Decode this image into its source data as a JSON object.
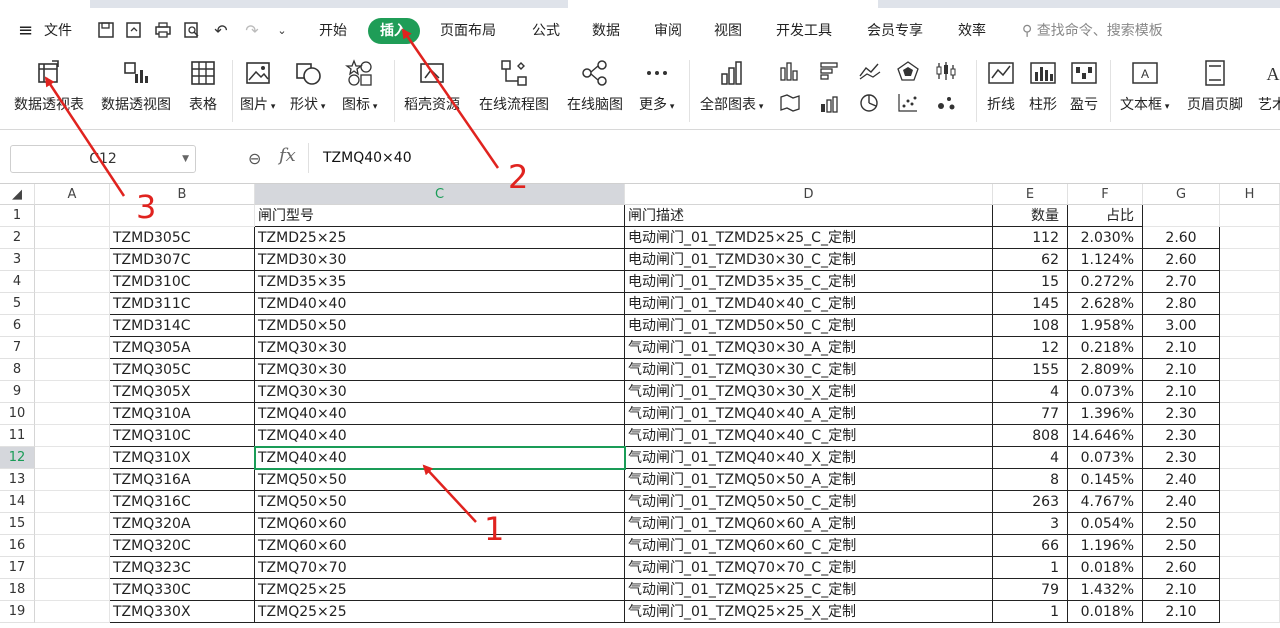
{
  "menu": {
    "file_label": "文件",
    "tabs": [
      "开始",
      "插入",
      "页面布局",
      "公式",
      "数据",
      "审阅",
      "视图",
      "开发工具",
      "会员专享",
      "效率"
    ],
    "search_placeholder": "查找命令、搜索模板"
  },
  "ribbon": {
    "pivot_table": "数据透视表",
    "pivot_chart": "数据透视图",
    "table": "表格",
    "picture": "图片",
    "shape": "形状",
    "icon": "图标",
    "resource": "稻壳资源",
    "flowchart": "在线流程图",
    "mindmap": "在线脑图",
    "more": "更多",
    "all_charts": "全部图表",
    "sparkline_line": "折线",
    "sparkline_column": "柱形",
    "sparkline_winloss": "盈亏",
    "textbox": "文本框",
    "header_footer": "页眉页脚",
    "wordart": "艺术"
  },
  "formula_bar": {
    "name_box": "C12",
    "fx": "fx",
    "content": "TZMQ40×40"
  },
  "columns": [
    "A",
    "B",
    "C",
    "D",
    "E",
    "F",
    "G",
    "H"
  ],
  "header_row": {
    "b": "",
    "c": "闸门型号",
    "d": "闸门描述",
    "e": "数量",
    "f": "占比",
    "g": ""
  },
  "rows": [
    {
      "n": "1"
    },
    {
      "n": "2",
      "b": "TZMD305C",
      "c": "TZMD25×25",
      "d": "电动闸门_01_TZMD25×25_C_定制",
      "e": "112",
      "f": "2.030%",
      "g": "2.60"
    },
    {
      "n": "3",
      "b": "TZMD307C",
      "c": "TZMD30×30",
      "d": "电动闸门_01_TZMD30×30_C_定制",
      "e": "62",
      "f": "1.124%",
      "g": "2.60"
    },
    {
      "n": "4",
      "b": "TZMD310C",
      "c": "TZMD35×35",
      "d": "电动闸门_01_TZMD35×35_C_定制",
      "e": "15",
      "f": "0.272%",
      "g": "2.70"
    },
    {
      "n": "5",
      "b": "TZMD311C",
      "c": "TZMD40×40",
      "d": "电动闸门_01_TZMD40×40_C_定制",
      "e": "145",
      "f": "2.628%",
      "g": "2.80"
    },
    {
      "n": "6",
      "b": "TZMD314C",
      "c": "TZMD50×50",
      "d": "电动闸门_01_TZMD50×50_C_定制",
      "e": "108",
      "f": "1.958%",
      "g": "3.00"
    },
    {
      "n": "7",
      "b": "TZMQ305A",
      "c": "TZMQ30×30",
      "d": "气动闸门_01_TZMQ30×30_A_定制",
      "e": "12",
      "f": "0.218%",
      "g": "2.10"
    },
    {
      "n": "8",
      "b": "TZMQ305C",
      "c": "TZMQ30×30",
      "d": "气动闸门_01_TZMQ30×30_C_定制",
      "e": "155",
      "f": "2.809%",
      "g": "2.10"
    },
    {
      "n": "9",
      "b": "TZMQ305X",
      "c": "TZMQ30×30",
      "d": "气动闸门_01_TZMQ30×30_X_定制",
      "e": "4",
      "f": "0.073%",
      "g": "2.10"
    },
    {
      "n": "10",
      "b": "TZMQ310A",
      "c": "TZMQ40×40",
      "d": "气动闸门_01_TZMQ40×40_A_定制",
      "e": "77",
      "f": "1.396%",
      "g": "2.30"
    },
    {
      "n": "11",
      "b": "TZMQ310C",
      "c": "TZMQ40×40",
      "d": "气动闸门_01_TZMQ40×40_C_定制",
      "e": "808",
      "f": "14.646%",
      "g": "2.30"
    },
    {
      "n": "12",
      "b": "TZMQ310X",
      "c": "TZMQ40×40",
      "d": "气动闸门_01_TZMQ40×40_X_定制",
      "e": "4",
      "f": "0.073%",
      "g": "2.30"
    },
    {
      "n": "13",
      "b": "TZMQ316A",
      "c": "TZMQ50×50",
      "d": "气动闸门_01_TZMQ50×50_A_定制",
      "e": "8",
      "f": "0.145%",
      "g": "2.40"
    },
    {
      "n": "14",
      "b": "TZMQ316C",
      "c": "TZMQ50×50",
      "d": "气动闸门_01_TZMQ50×50_C_定制",
      "e": "263",
      "f": "4.767%",
      "g": "2.40"
    },
    {
      "n": "15",
      "b": "TZMQ320A",
      "c": "TZMQ60×60",
      "d": "气动闸门_01_TZMQ60×60_A_定制",
      "e": "3",
      "f": "0.054%",
      "g": "2.50"
    },
    {
      "n": "16",
      "b": "TZMQ320C",
      "c": "TZMQ60×60",
      "d": "气动闸门_01_TZMQ60×60_C_定制",
      "e": "66",
      "f": "1.196%",
      "g": "2.50"
    },
    {
      "n": "17",
      "b": "TZMQ323C",
      "c": "TZMQ70×70",
      "d": "气动闸门_01_TZMQ70×70_C_定制",
      "e": "1",
      "f": "0.018%",
      "g": "2.60"
    },
    {
      "n": "18",
      "b": "TZMQ330C",
      "c": "TZMQ25×25",
      "d": "气动闸门_01_TZMQ25×25_C_定制",
      "e": "79",
      "f": "1.432%",
      "g": "2.10"
    },
    {
      "n": "19",
      "b": "TZMQ330X",
      "c": "TZMQ25×25",
      "d": "气动闸门_01_TZMQ25×25_X_定制",
      "e": "1",
      "f": "0.018%",
      "g": "2.10"
    }
  ],
  "annotations": [
    "1",
    "2",
    "3"
  ],
  "colors": {
    "accent": "#1f9d57",
    "annotation": "#e0231f"
  }
}
